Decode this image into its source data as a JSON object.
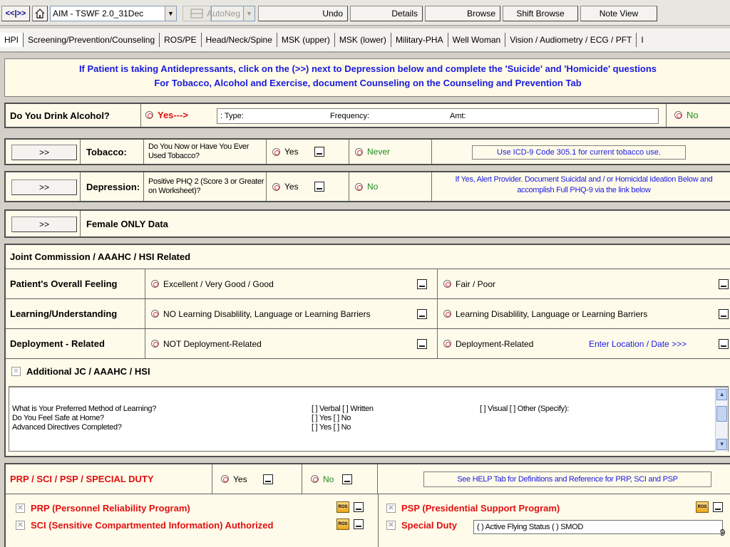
{
  "toolbar": {
    "nav_label": "<<|>>",
    "template_select": "AIM - TSWF 2.0_31Dec",
    "autoneg_select": "AutoNeg",
    "undo": "Undo",
    "details": "Details",
    "browse": "Browse",
    "shift_browse": "Shift Browse",
    "note_view": "Note View"
  },
  "tabs": [
    "HPI",
    "Screening/Prevention/Counseling",
    "ROS/PE",
    "Head/Neck/Spine",
    "MSK (upper)",
    "MSK (lower)",
    "Military-PHA",
    "Well Woman",
    "Vision / Audiometry / ECG / PFT",
    "I"
  ],
  "banner": {
    "line1": "If Patient is taking Antidepressants, click on the (>>) next to Depression below and complete the 'Suicide' and 'Homicide' questions",
    "line2": "For Tobacco, Alcohol and Exercise, document Counseling on the Counseling and Prevention Tab"
  },
  "alcohol": {
    "label": "Do You Drink Alcohol?",
    "yes": "Yes--->",
    "type": ": Type:",
    "frequency": "Frequency:",
    "amt": "Amt:",
    "no": "No"
  },
  "tobacco": {
    "button": ">>",
    "label": "Tobacco:",
    "question": "Do You Now or Have You Ever Used Tobacco?",
    "yes": "Yes",
    "never": "Never",
    "note": "Use ICD-9 Code 305.1 for current tobacco use."
  },
  "depression": {
    "button": ">>",
    "label": "Depression:",
    "question": "Positive PHQ 2 (Score 3 or Greater on Worksheet)?",
    "yes": "Yes",
    "no": "No",
    "note": "If Yes, Alert Provider.  Document Suicidal and / or Homicidal Ideation Below and accomplish Full PHQ-9 via the link below"
  },
  "female": {
    "button": ">>",
    "label": "Female ONLY Data"
  },
  "joint": {
    "header": "Joint Commission / AAAHC / HSI Related",
    "rows": [
      {
        "label": "Patient's Overall Feeling",
        "opt1": "Excellent / Very Good / Good",
        "opt2": "Fair / Poor",
        "extra": ""
      },
      {
        "label": "Learning/Understanding",
        "opt1": "NO Learning Disablility, Language or Learning Barriers",
        "opt2": "Learning Disablility, Language or Learning Barriers",
        "extra": ""
      },
      {
        "label": "Deployment - Related",
        "opt1": "NOT Deployment-Related",
        "opt2": "Deployment-Related",
        "extra": "Enter Location / Date  >>>"
      }
    ],
    "additional": "Additional JC / AAAHC / HSI",
    "text": {
      "q1": "What is Your Preferred Method of Learning?",
      "q1a": "[ ] Verbal [ ] Written",
      "q1b": "[ ] Visual   [ ] Other (Specify):",
      "q2": "Do You Feel Safe at Home?",
      "q2a": "[ ] Yes   [ ] No",
      "q3": "Advanced Directives Completed?",
      "q3a": "[ ] Yes   [ ] No"
    }
  },
  "prp": {
    "label": "PRP / SCI / PSP / SPECIAL DUTY",
    "yes": "Yes",
    "no": "No",
    "help": "See HELP Tab for Definitions and Reference for PRP, SCI and PSP",
    "prp_item": "PRP (Personnel Reliability Program)",
    "sci_item": "SCI (Sensitive Compartmented Information) Authorized",
    "psp_item": "PSP (Presidential Support Program)",
    "special": "Special Duty",
    "special_value": "( ) Active Flying Status  ( ) SMOD",
    "ros_icon": "ROS"
  },
  "page_number": "9",
  "colors": {
    "blue_text": "#1a1ae0",
    "green_text": "#1f8a1f",
    "red_text": "#e01010"
  }
}
